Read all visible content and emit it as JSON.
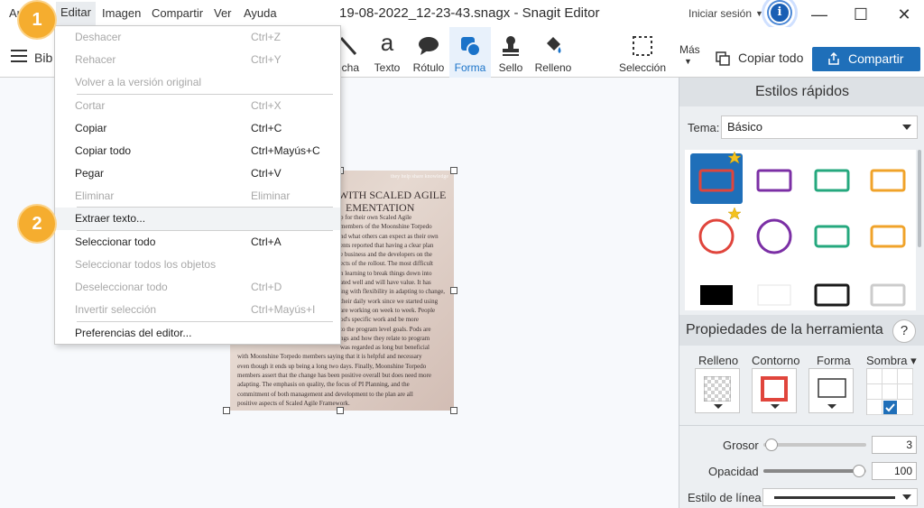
{
  "menubar": {
    "items": [
      "Archivo",
      "Editar",
      "Imagen",
      "Compartir",
      "Ver",
      "Ayuda"
    ],
    "archivo_partial": "Ar",
    "window_title": "19-08-2022_12-23-43.snagx - Snagit Editor",
    "login": "Iniciar sesión",
    "info_icon_glyph": "i"
  },
  "toolbar": {
    "library_label": "Bib",
    "tools": [
      {
        "label": "Flecha",
        "partial": "echa",
        "icon": "arrow-icon"
      },
      {
        "label": "Texto",
        "icon": "text-icon"
      },
      {
        "label": "Rótulo",
        "icon": "callout-icon"
      },
      {
        "label": "Forma",
        "icon": "shape-icon",
        "selected": true
      },
      {
        "label": "Sello",
        "icon": "stamp-icon"
      },
      {
        "label": "Relleno",
        "icon": "fill-icon"
      },
      {
        "label": "Selección",
        "icon": "selection-icon"
      }
    ],
    "text_tool_glyph": "a",
    "more_label": "Más",
    "copy_all_label": "Copiar todo",
    "share_label": "Compartir"
  },
  "edit_menu": {
    "items": [
      {
        "label": "Deshacer",
        "shortcut": "Ctrl+Z",
        "enabled": false
      },
      {
        "label": "Rehacer",
        "shortcut": "Ctrl+Y",
        "enabled": false
      },
      {
        "label": "Volver a la versión original",
        "shortcut": "",
        "enabled": false
      },
      {
        "label": "Cortar",
        "shortcut": "Ctrl+X",
        "enabled": false
      },
      {
        "label": "Copiar",
        "shortcut": "Ctrl+C",
        "enabled": true
      },
      {
        "label": "Copiar todo",
        "shortcut": "Ctrl+Mayús+C",
        "enabled": true
      },
      {
        "label": "Pegar",
        "shortcut": "Ctrl+V",
        "enabled": true
      },
      {
        "label": "Eliminar",
        "shortcut": "Eliminar",
        "enabled": false
      },
      {
        "label": "Extraer texto...",
        "shortcut": "",
        "enabled": true,
        "highlighted": true
      },
      {
        "label": "Seleccionar todo",
        "shortcut": "Ctrl+A",
        "enabled": true
      },
      {
        "label": "Seleccionar todos los objetos",
        "shortcut": "",
        "enabled": false
      },
      {
        "label": "Deseleccionar todo",
        "shortcut": "Ctrl+D",
        "enabled": false
      },
      {
        "label": "Invertir selección",
        "shortcut": "Ctrl+Mayús+I",
        "enabled": false
      },
      {
        "label": "Preferencias del editor...",
        "shortcut": "",
        "enabled": true
      }
    ]
  },
  "badges": [
    "1",
    "2"
  ],
  "document": {
    "top_caption": "they help share knowledge",
    "heading_lines": [
      "WITH SCALED AGILE",
      "EMENTATION"
    ],
    "body_lines": [
      "p for their own Scaled Agile",
      "members of the Moonshine Torpedo",
      "nd what others can expect as their own",
      "ents reported that having a clear plan",
      "e business and the developers on the",
      "ects of the rollout. The most difficult",
      "n learning to break things down into",
      "ated well and will have value. It has",
      "ing with flexibility in adapting to change,",
      "their daily work since we started using",
      "are working on week to week. People",
      "od's specific work and be more",
      "to the program level goals. Pods are",
      "ngs and how they relate to program",
      "was regarded as long but beneficial",
      "with Moonshine Torpedo members saying that it is helpful and necessary",
      "even though it ends up being a long two days. Finally, Moonshine Torpedo",
      "members assert that the change has been positive overall but does need more",
      "adapting. The emphasis on quality, the focus of PI Planning, and the",
      "commitment of both management and development to the plan are all",
      "positive aspects of Scaled Agile Framework."
    ]
  },
  "quick_styles": {
    "title": "Estilos rápidos",
    "theme_label": "Tema:",
    "theme_value": "Básico",
    "swatches": [
      {
        "shape": "rect",
        "color": "#e0453c",
        "selected": true,
        "favorite": true
      },
      {
        "shape": "rect",
        "color": "#7b2fa5"
      },
      {
        "shape": "rect",
        "color": "#25a87e"
      },
      {
        "shape": "rect",
        "color": "#f0a32a"
      },
      {
        "shape": "circle",
        "color": "#e0453c",
        "favorite": true
      },
      {
        "shape": "circle",
        "color": "#7b2fa5"
      },
      {
        "shape": "rect",
        "color": "#25a87e"
      },
      {
        "shape": "rect",
        "color": "#f0a32a"
      },
      {
        "shape": "solid",
        "color": "#000000"
      },
      {
        "shape": "solid",
        "color": "#ffffff"
      },
      {
        "shape": "rect",
        "color": "#1a1a1a"
      },
      {
        "shape": "rect",
        "color": "#cccccc"
      }
    ]
  },
  "tool_props": {
    "title": "Propiedades de la herramienta",
    "help_glyph": "?",
    "fill_label": "Relleno",
    "outline_label": "Contorno",
    "shape_label": "Forma",
    "shadow_label": "Sombra",
    "thickness_label": "Grosor",
    "thickness_value": "3",
    "opacity_label": "Opacidad",
    "opacity_value": "100",
    "line_style_label": "Estilo de línea",
    "outline_color": "#e0453c"
  }
}
